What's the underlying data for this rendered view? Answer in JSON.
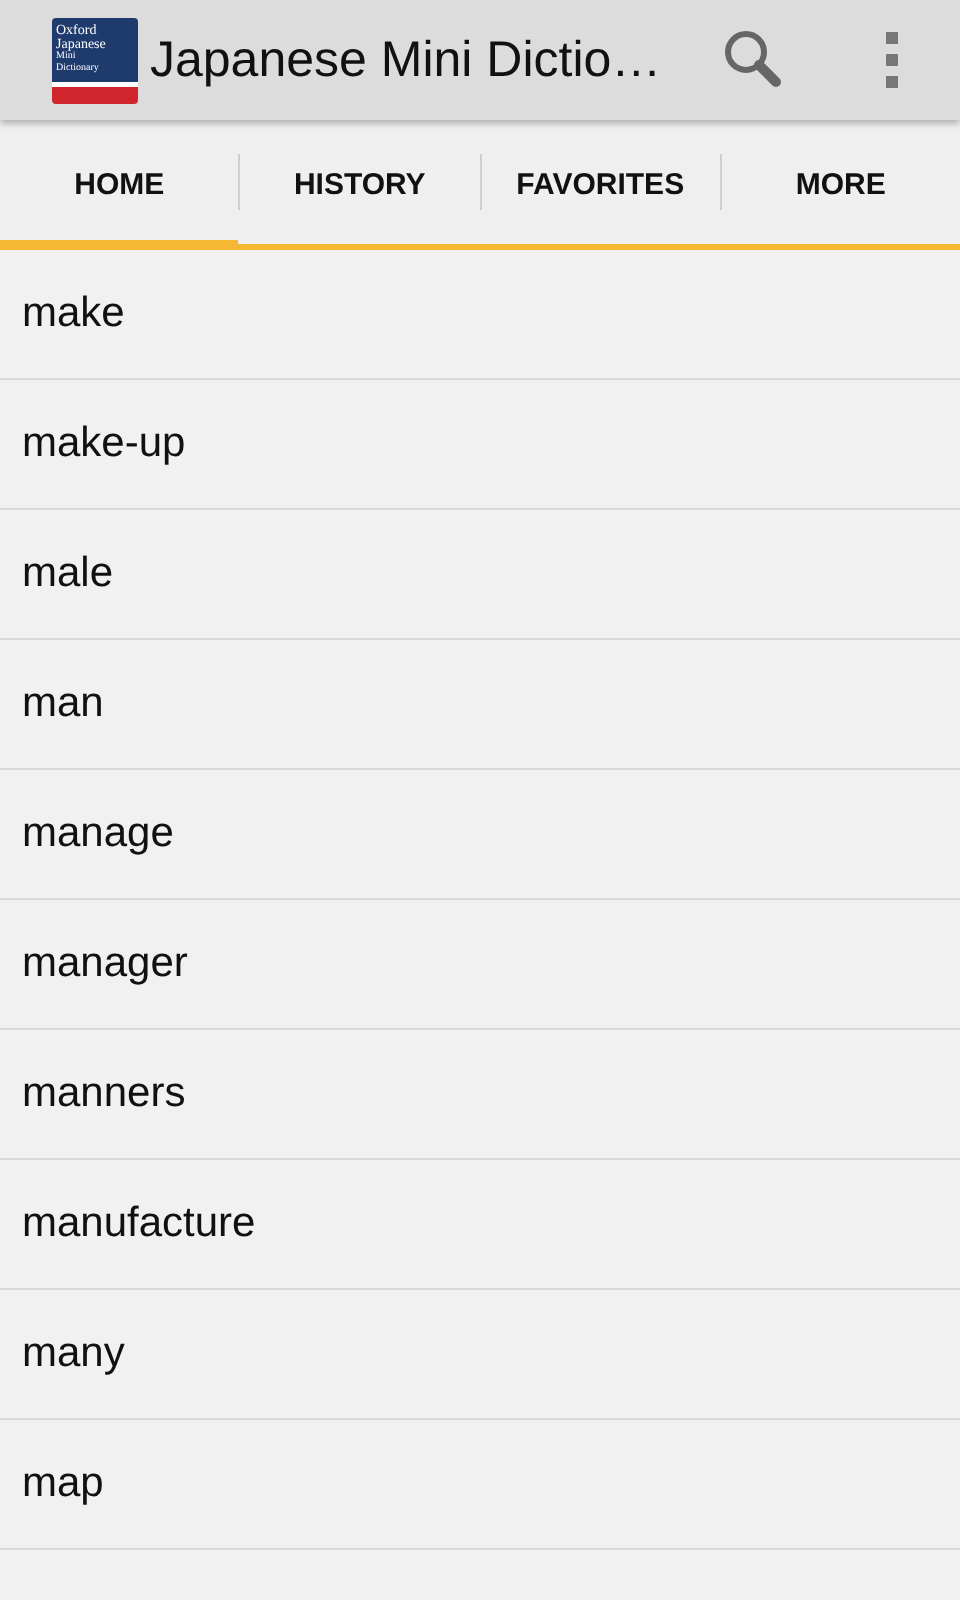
{
  "app_bar": {
    "logo_lines": [
      "Oxford",
      "Japanese",
      "Mini",
      "Dictionary"
    ],
    "title": "Japanese Mini Dictio…"
  },
  "tabs": [
    {
      "label": "HOME",
      "selected": true
    },
    {
      "label": "HISTORY",
      "selected": false
    },
    {
      "label": "FAVORITES",
      "selected": false
    },
    {
      "label": "MORE",
      "selected": false
    }
  ],
  "words": [
    "make",
    "make-up",
    "male",
    "man",
    "manage",
    "manager",
    "manners",
    "manufacture",
    "many",
    "map"
  ]
}
